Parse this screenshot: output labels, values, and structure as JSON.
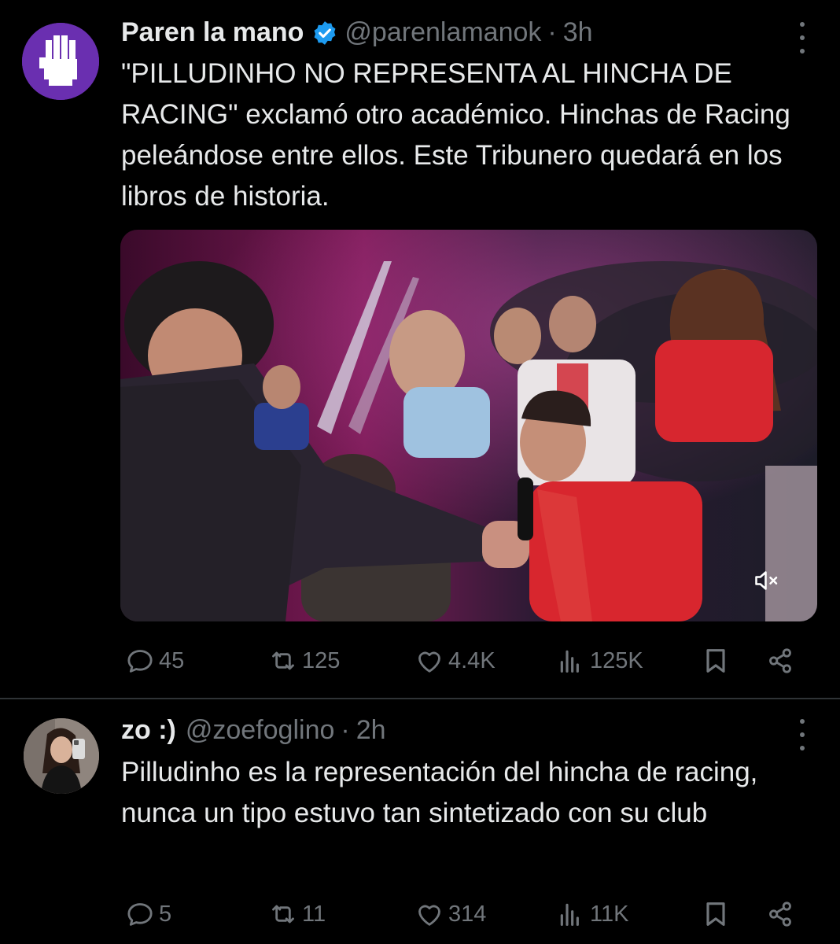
{
  "tweets": [
    {
      "display_name": "Paren la mano",
      "verified": true,
      "handle": "@parenlamanok",
      "separator": "·",
      "time": "3h",
      "text": "\"PILLUDINHO NO REPRESENTA AL HINCHA DE RACING\" exclamó otro académico. Hinchas de Racing peleándose entre ellos. Este Tribunero quedará en los libros de historia.",
      "has_video": true,
      "video_muted": true,
      "stats": {
        "replies": "45",
        "reposts": "125",
        "likes": "4.4K",
        "views": "125K"
      }
    },
    {
      "display_name": "zo :)",
      "verified": false,
      "handle": "@zoefoglino",
      "separator": "·",
      "time": "2h",
      "text": "Pilludinho es la representación del hincha de racing, nunca un tipo estuvo tan sintetizado con su club",
      "has_video": false,
      "stats": {
        "replies": "5",
        "reposts": "11",
        "likes": "314",
        "views": "11K"
      }
    }
  ],
  "icons": [
    "verified-badge-icon",
    "more-icon",
    "reply-icon",
    "repost-icon",
    "like-icon",
    "views-icon",
    "bookmark-icon",
    "share-icon",
    "mute-icon"
  ],
  "colors": {
    "background": "#000000",
    "text": "#e7e9ea",
    "secondary": "#71767b",
    "verified": "#1d9bf0",
    "avatar_brand": "#6a2fb0"
  }
}
